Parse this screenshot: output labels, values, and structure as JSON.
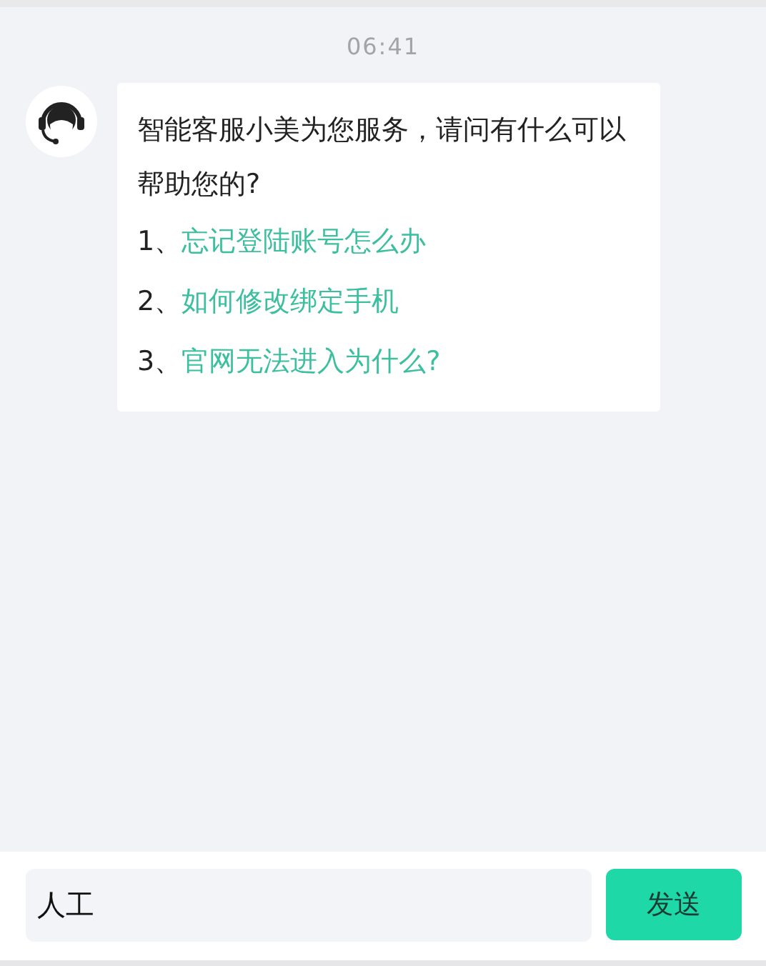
{
  "time": "06:41",
  "message": {
    "text": "智能客服小美为您服务，请问有什么可以帮助您的?",
    "options": [
      {
        "number": "1、",
        "label": "忘记登陆账号怎么办"
      },
      {
        "number": "2、",
        "label": "如何修改绑定手机"
      },
      {
        "number": "3、",
        "label": "官网无法进入为什么?"
      }
    ]
  },
  "input": {
    "value": "人工"
  },
  "send_button": "发送"
}
